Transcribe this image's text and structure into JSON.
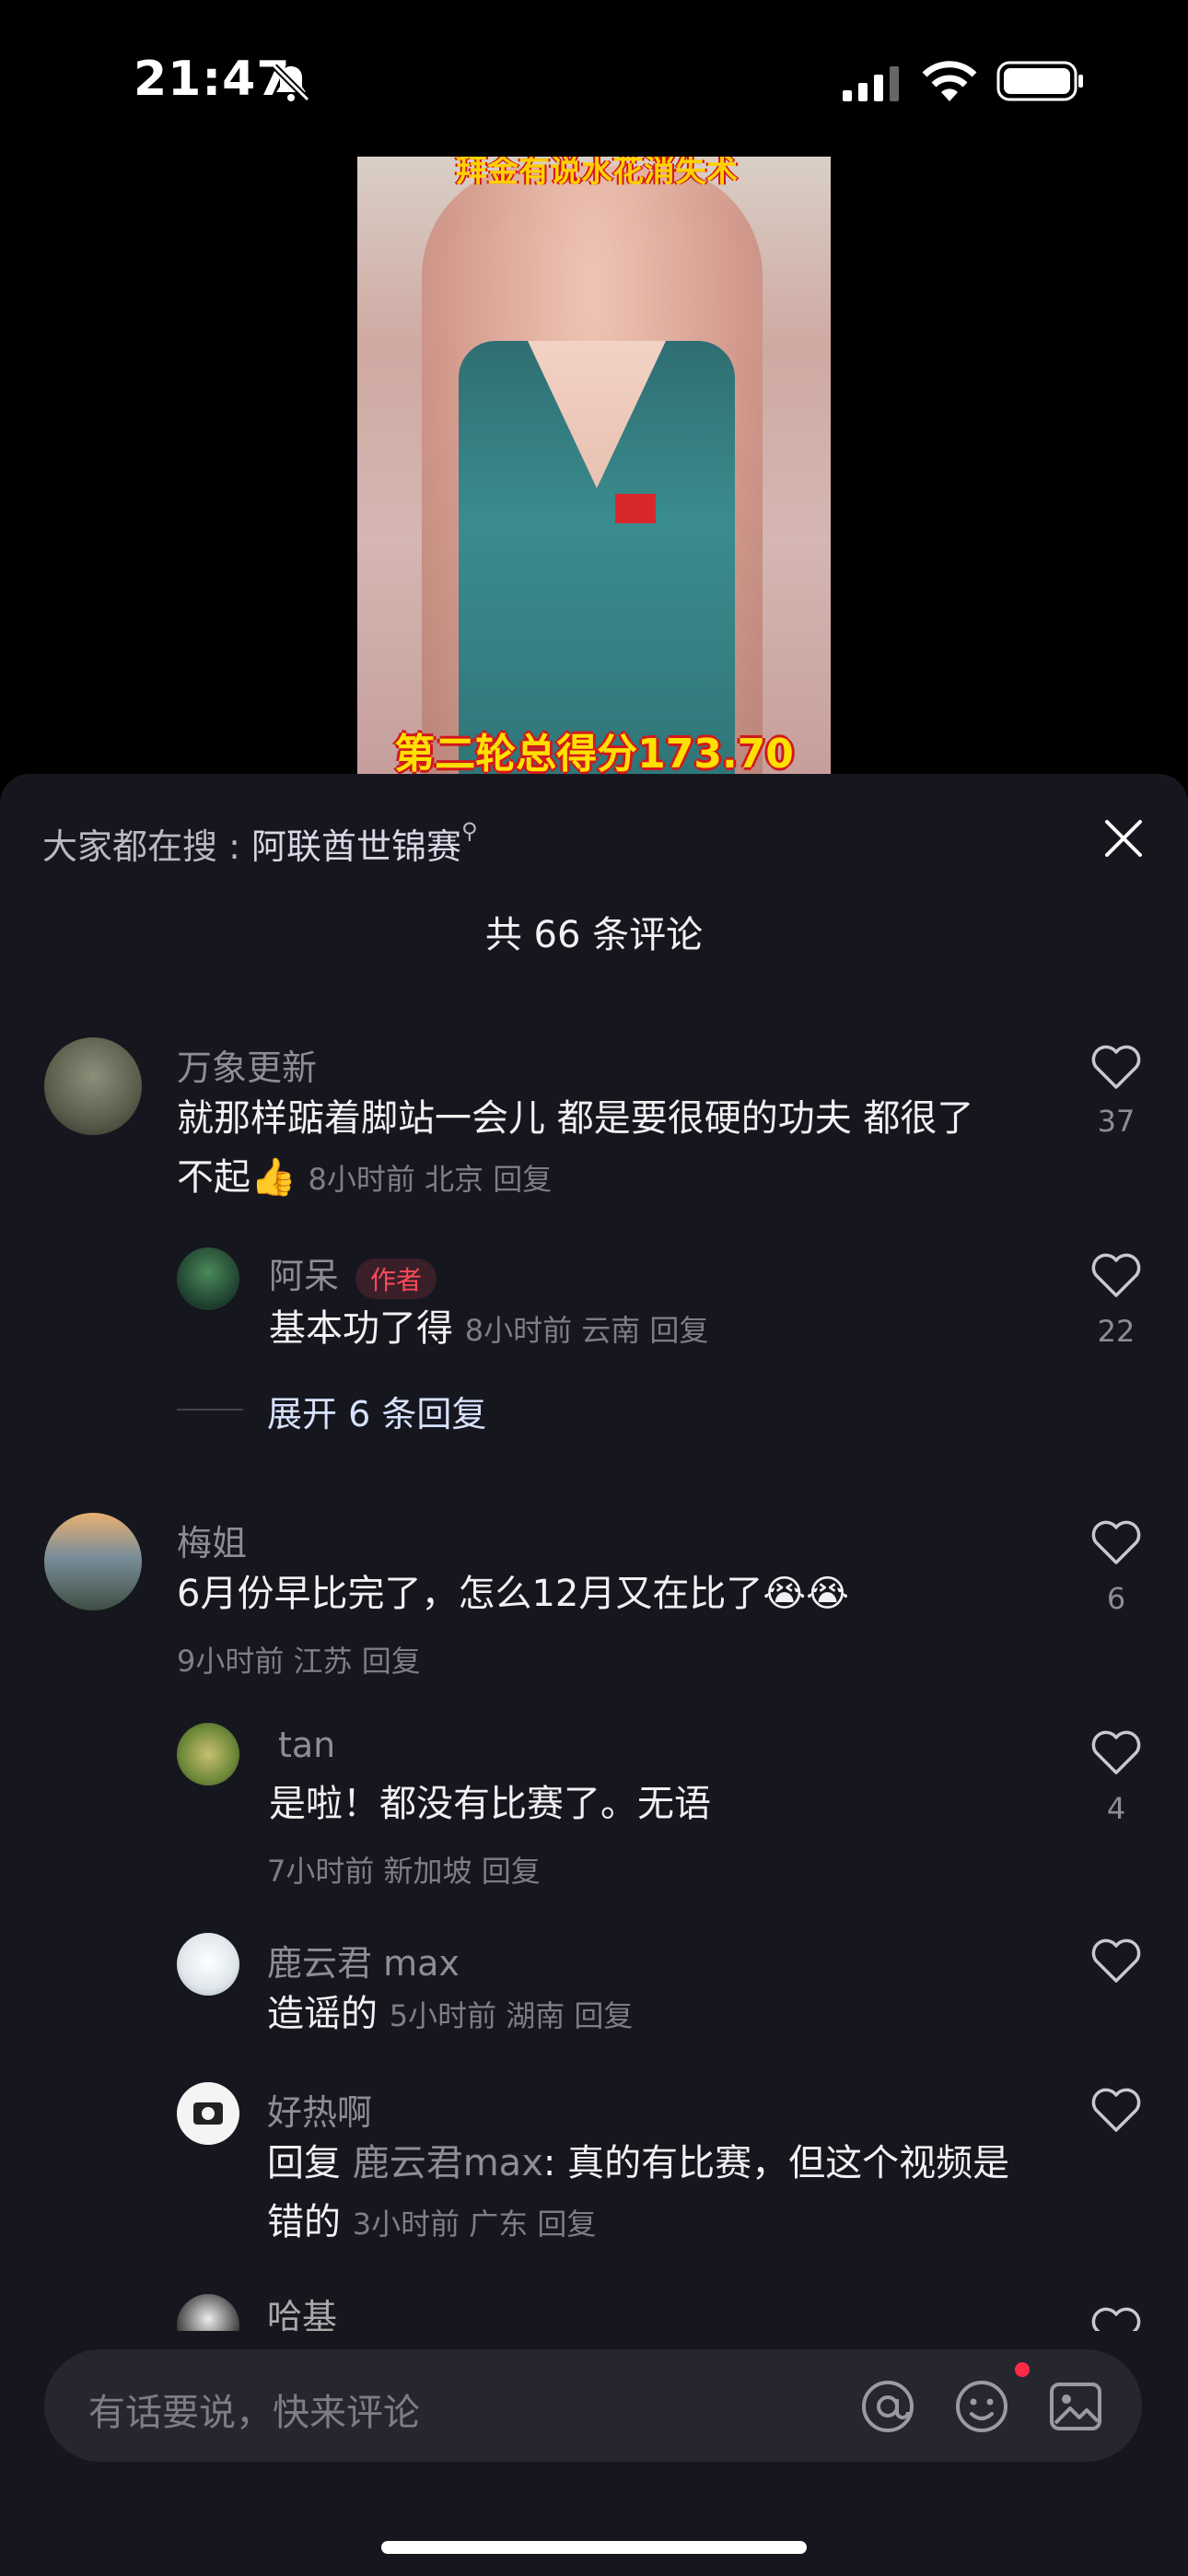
{
  "status_bar": {
    "time": "21:47"
  },
  "video": {
    "caption_top": "拜金有说水花消失术",
    "caption_bottom": "第二轮总得分173.70"
  },
  "sheet": {
    "search_prefix": "大家都在搜 : ",
    "search_keyword": "阿联酋世锦赛",
    "comment_count": "共 66 条评论"
  },
  "comments": [
    {
      "name": "万象更新",
      "text_line1": "就那样踮着脚站一会儿 都是要很硬的功夫 都很了",
      "text_line2": "不起👍",
      "meta": "8小时前 北京 回复",
      "likes": "37"
    },
    {
      "name": "阿呆",
      "badge": "作者",
      "text": "基本功了得",
      "meta": "8小时前 云南 回复",
      "likes": "22"
    },
    {
      "expand": "展开 6 条回复"
    },
    {
      "name": "梅姐",
      "text": "6月份早比完了，怎么12月又在比了😭😭",
      "meta": "9小时前 江苏 回复",
      "likes": "6"
    },
    {
      "name": "tan",
      "text": "是啦！都没有比赛了。无语",
      "meta": "7小时前 新加坡 回复",
      "likes": "4"
    },
    {
      "name": "鹿云君 max",
      "text": "造谣的",
      "meta": "5小时前 湖南 回复",
      "likes": ""
    },
    {
      "name": "好热啊",
      "text_prefix": "回复 ",
      "text_ref": "鹿云君max",
      "text_rest": ": 真的有比赛，但这个视频是",
      "text_line2": "错的",
      "meta": "3小时前 广东 回复",
      "likes": ""
    },
    {
      "name": "哈基"
    }
  ],
  "input": {
    "placeholder": "有话要说，快来评论"
  },
  "colors": {
    "sheet_bg": "#16161e",
    "accent_red": "#ff2a48"
  }
}
